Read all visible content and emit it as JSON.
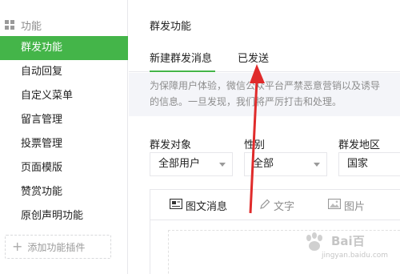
{
  "sidebar": {
    "section_title": "功能",
    "items": [
      {
        "label": "群发功能",
        "active": true
      },
      {
        "label": "自动回复",
        "active": false
      },
      {
        "label": "自定义菜单",
        "active": false
      },
      {
        "label": "留言管理",
        "active": false
      },
      {
        "label": "投票管理",
        "active": false
      },
      {
        "label": "页面模版",
        "active": false
      },
      {
        "label": "赞赏功能",
        "active": false
      },
      {
        "label": "原创声明功能",
        "active": false
      }
    ],
    "add_plugin_label": "添加功能插件"
  },
  "main": {
    "title": "群发功能",
    "tabs": [
      {
        "label": "新建群发消息",
        "active": true
      },
      {
        "label": "已发送",
        "active": false
      }
    ],
    "notice_line1": "为保障用户体验，微信公众平台严禁恶意营销以及诱导",
    "notice_line2": "的信息。一旦发现，我们将严厉打击和处理。",
    "filters": {
      "target_label": "群发对象",
      "target_value": "全部用户",
      "gender_label": "性别",
      "gender_value": "全部",
      "region_label": "群发地区",
      "region_value": "国家"
    },
    "editor_tools": {
      "news": "图文消息",
      "text": "文字",
      "image": "图片"
    }
  },
  "watermark": {
    "brand": "Bai百",
    "url": "jingyan.baidu.com"
  },
  "colors": {
    "accent": "#44b549",
    "arrow": "#e02b2b",
    "notice_bg": "#f4f5f9"
  }
}
